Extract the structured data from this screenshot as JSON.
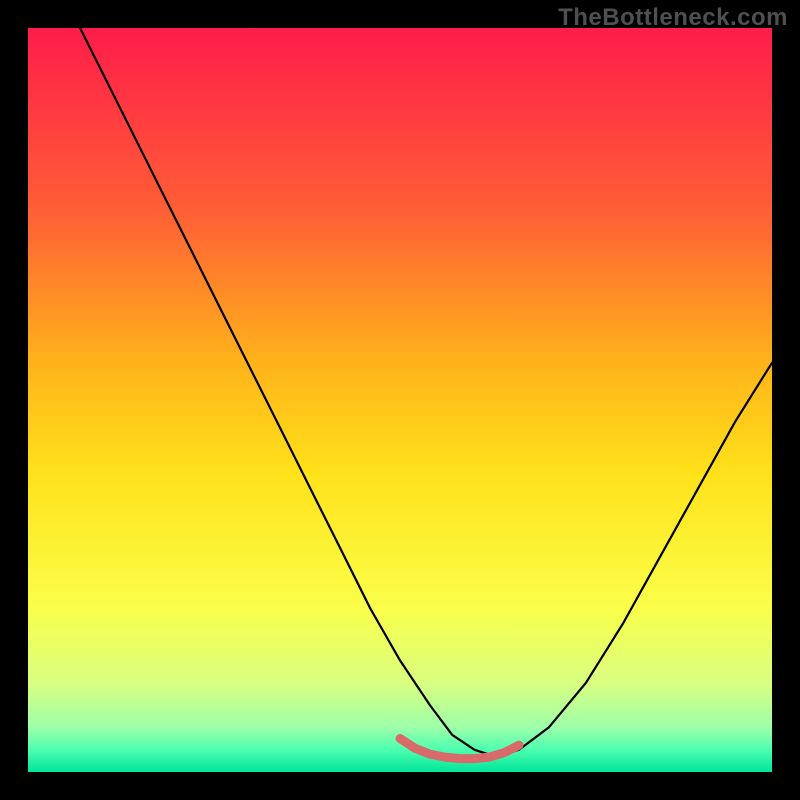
{
  "watermark": "TheBottleneck.com",
  "chart_data": {
    "type": "line",
    "title": "",
    "xlabel": "",
    "ylabel": "",
    "xlim": [
      0,
      100
    ],
    "ylim": [
      0,
      100
    ],
    "grid": false,
    "legend": false,
    "background_gradient": {
      "stops": [
        {
          "offset": 0.0,
          "color": "#ff1c4a"
        },
        {
          "offset": 0.25,
          "color": "#ff6035"
        },
        {
          "offset": 0.45,
          "color": "#ffb31a"
        },
        {
          "offset": 0.6,
          "color": "#ffe21a"
        },
        {
          "offset": 0.78,
          "color": "#faff4a"
        },
        {
          "offset": 0.88,
          "color": "#d9ff80"
        },
        {
          "offset": 0.94,
          "color": "#9dffa8"
        },
        {
          "offset": 0.97,
          "color": "#4dffb0"
        },
        {
          "offset": 1.0,
          "color": "#00e59a"
        }
      ]
    },
    "series": [
      {
        "name": "bottleneck-curve",
        "stroke": "#000000",
        "x": [
          7,
          10,
          14,
          18,
          22,
          26,
          30,
          34,
          38,
          42,
          46,
          50,
          54,
          57,
          60,
          63,
          66,
          70,
          75,
          80,
          85,
          90,
          95,
          100
        ],
        "y": [
          100,
          94,
          86,
          78,
          70,
          62,
          54,
          46,
          38,
          30,
          22,
          15,
          9,
          5,
          3,
          2,
          3,
          6,
          12,
          20,
          29,
          38,
          47,
          55
        ]
      },
      {
        "name": "optimal-band",
        "stroke": "#d86a6a",
        "x": [
          50,
          52,
          54,
          56,
          58,
          60,
          62,
          64,
          66
        ],
        "y": [
          4.5,
          3.2,
          2.4,
          2.0,
          1.8,
          1.8,
          2.0,
          2.6,
          3.6
        ]
      }
    ]
  }
}
